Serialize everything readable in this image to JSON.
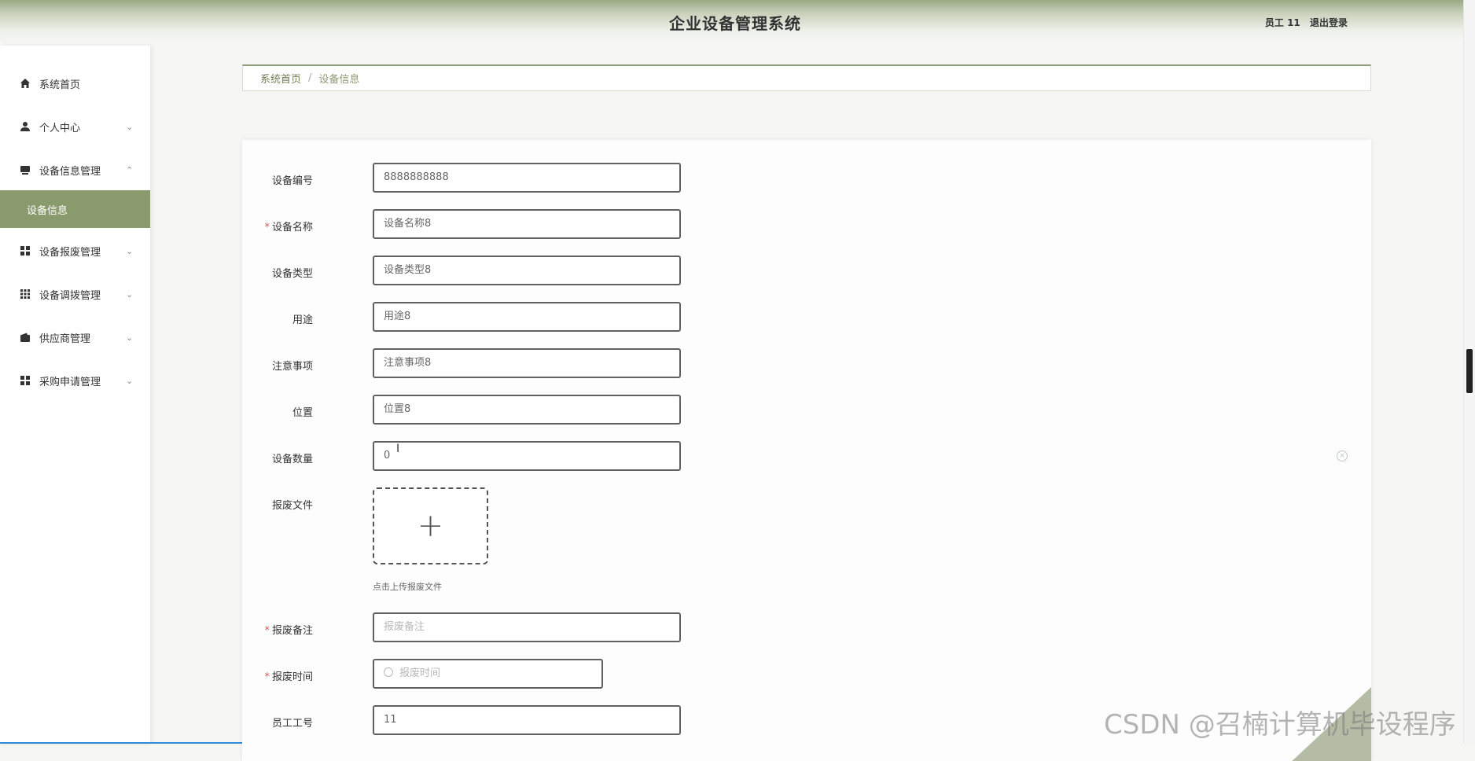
{
  "header": {
    "title": "企业设备管理系统",
    "user": "员工 11",
    "logout": "退出登录"
  },
  "sidebar": {
    "items": [
      {
        "label": "系统首页",
        "icon": "home-icon"
      },
      {
        "label": "个人中心",
        "icon": "user-icon",
        "chevron": "⌄"
      },
      {
        "label": "设备信息管理",
        "icon": "device-icon",
        "chevron": "⌃"
      },
      {
        "label": "设备信息",
        "active": true
      },
      {
        "label": "设备报废管理",
        "icon": "grid-icon",
        "chevron": "⌄"
      },
      {
        "label": "设备调拨管理",
        "icon": "apps-icon",
        "chevron": "⌄"
      },
      {
        "label": "供应商管理",
        "icon": "wallet-icon",
        "chevron": "⌄"
      },
      {
        "label": "采购申请管理",
        "icon": "grid-icon",
        "chevron": "⌄"
      }
    ]
  },
  "breadcrumb": {
    "home": "系统首页",
    "separator": "/",
    "current": "设备信息"
  },
  "form": {
    "fields": [
      {
        "label": "设备编号",
        "value": "8888888888"
      },
      {
        "label": "设备名称",
        "value": "设备名称8",
        "required": true
      },
      {
        "label": "设备类型",
        "value": "设备类型8"
      },
      {
        "label": "用途",
        "value": "用途8"
      },
      {
        "label": "注意事项",
        "value": "注意事项8"
      },
      {
        "label": "位置",
        "value": "位置8"
      },
      {
        "label": "设备数量",
        "value": "0"
      }
    ],
    "upload": {
      "label": "报废文件",
      "plus": "+",
      "hint": "点击上传报废文件"
    },
    "remark": {
      "label": "报废备注",
      "placeholder": "报废备注",
      "required": true
    },
    "time": {
      "label": "报废时间",
      "placeholder": "报废时间",
      "required": true
    },
    "employee": {
      "label": "员工工号",
      "value": "11"
    },
    "required_mark": "*",
    "clear_icon": "×"
  },
  "watermark": "CSDN @召楠计算机毕设程序",
  "colors": {
    "accent": "#899a6c",
    "header_dark": "#9aa985",
    "required": "#e25656"
  }
}
